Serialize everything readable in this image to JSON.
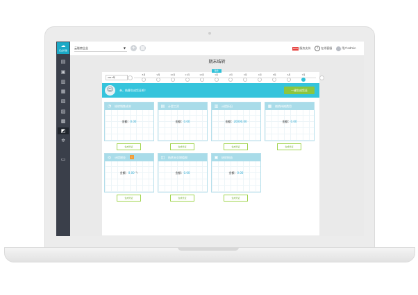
{
  "app": {
    "logo_glyph": "☁",
    "logo_text": "亿企代账"
  },
  "topbar": {
    "company_name": "云账房企业",
    "add_icon": "plus-icon",
    "menu_icon": "grid-icon",
    "new_badge": "NEW",
    "guide_label": "服务支持",
    "help_label": "在线客服",
    "user_label": "用户admin"
  },
  "sidebar": {
    "items": [
      {
        "icon": "document-icon",
        "glyph": "▤"
      },
      {
        "icon": "voucher-icon",
        "glyph": "▣"
      },
      {
        "icon": "chart-icon",
        "glyph": "▥"
      },
      {
        "icon": "ledger-icon",
        "glyph": "▦"
      },
      {
        "icon": "report-icon",
        "glyph": "▧"
      },
      {
        "icon": "tax-icon",
        "glyph": "▨"
      },
      {
        "icon": "print-icon",
        "glyph": "▩"
      },
      {
        "icon": "close-period-icon",
        "glyph": "◩"
      },
      {
        "icon": "settings-icon",
        "glyph": "✲"
      },
      {
        "icon": "archive-icon",
        "glyph": "▭"
      }
    ]
  },
  "page": {
    "title": "期末结转"
  },
  "timeline": {
    "year": "2017年",
    "current_tag": "当前",
    "months": [
      "8月",
      "9月",
      "10月",
      "11月",
      "12月",
      "1月",
      "2月",
      "3月",
      "4月",
      "5月",
      "6月",
      "7月"
    ],
    "active_index": 11,
    "tagged_index": 5
  },
  "banner": {
    "text": "亲，结算生成凭证吧！",
    "button": "一键生成凭证",
    "mascot": "☺"
  },
  "cards": [
    {
      "title": "结转销售成本",
      "icon": "cost-icon",
      "glyph": "◔",
      "amount_label": "金额：",
      "amount": "0.00",
      "button": "生成凭证"
    },
    {
      "title": "计提工资",
      "icon": "salary-icon",
      "glyph": "▤",
      "amount_label": "金额：",
      "amount": "0.00",
      "button": "生成凭证"
    },
    {
      "title": "计提折旧",
      "icon": "depreciation-icon",
      "glyph": "▥",
      "amount_label": "金额：",
      "amount": "20000.00",
      "button": "生成凭证"
    },
    {
      "title": "摊销待摊费用",
      "icon": "amortize-icon",
      "glyph": "▦",
      "amount_label": "金额：",
      "amount": "0.00",
      "button": "生成凭证"
    },
    {
      "title": "计提税金",
      "icon": "tax-icon",
      "glyph": "◎",
      "badge": "!",
      "amount_label": "金额：",
      "amount": "0.00",
      "button": "生成凭证"
    },
    {
      "title": "结转未交增值税",
      "icon": "vat-icon",
      "glyph": "◫",
      "amount_label": "金额：",
      "amount": "0.00",
      "button": "生成凭证"
    },
    {
      "title": "结转损益",
      "icon": "profit-loss-icon",
      "glyph": "▣",
      "amount_label": "金额：",
      "amount": "0.00",
      "button": "生成凭证"
    }
  ],
  "colors": {
    "accent": "#35c4dc",
    "card_head": "#a9dce9",
    "button_green": "#8cc63e",
    "amount_blue": "#2aa9d2",
    "sidebar": "#3a3f4a"
  }
}
